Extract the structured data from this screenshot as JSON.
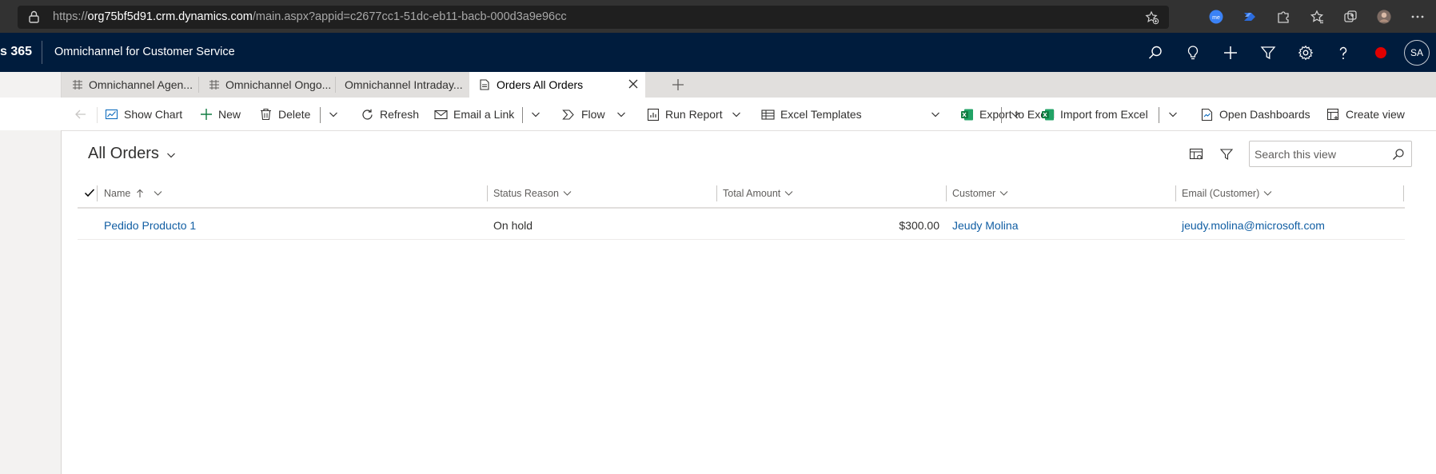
{
  "browser": {
    "url_prefix": "https://",
    "url_host": "org75bf5d91.crm.dynamics.com",
    "url_path": "/main.aspx?appid=c2677cc1-51dc-eb11-bacb-000d3a9e96cc",
    "icons": [
      "lock-icon",
      "favorite-add-icon",
      "extension-me-icon",
      "power-automate-icon",
      "extensions-icon",
      "favorites-icon",
      "collections-icon",
      "profile-avatar",
      "more-icon"
    ]
  },
  "appbar": {
    "brand": "s 365",
    "title": "Omnichannel for Customer Service",
    "avatar_initials": "SA"
  },
  "tabs": [
    {
      "label": "Omnichannel Agen..."
    },
    {
      "label": "Omnichannel Ongo..."
    },
    {
      "label": "Omnichannel Intraday..."
    },
    {
      "label": "Orders All Orders"
    }
  ],
  "commands": {
    "show_chart": "Show Chart",
    "new": "New",
    "delete": "Delete",
    "refresh": "Refresh",
    "email_link": "Email a Link",
    "flow": "Flow",
    "run_report": "Run Report",
    "excel_templates": "Excel Templates",
    "export_excel": "Export to Excel",
    "import_excel": "Import from Excel",
    "open_dashboards": "Open Dashboards",
    "create_view": "Create view"
  },
  "view": {
    "title": "All Orders",
    "search_placeholder": "Search this view"
  },
  "grid": {
    "columns": [
      "Name",
      "Status Reason",
      "Total Amount",
      "Customer",
      "Email (Customer)"
    ],
    "rows": [
      {
        "name": "Pedido Producto 1",
        "status": "On hold",
        "amount": "$300.00",
        "customer": "Jeudy Molina",
        "email": "jeudy.molina@microsoft.com"
      }
    ]
  },
  "colors": {
    "appbar": "#001c3d",
    "link": "#115ea3",
    "excel_green": "#107c41"
  }
}
